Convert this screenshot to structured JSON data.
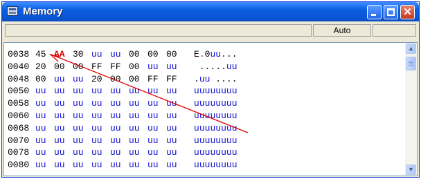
{
  "window": {
    "title": "Memory",
    "auto_label": "Auto",
    "accent_color": "#0a5de0",
    "close_color": "#c4381c"
  },
  "memory": {
    "highlight_color": "#e00000",
    "undefined_color": "#1010d0",
    "rows": [
      {
        "address": "0038",
        "bytes": [
          "45",
          "AA",
          "30",
          "uu",
          "uu",
          "00",
          "00",
          "00"
        ],
        "ascii": "E.0uu..."
      },
      {
        "address": "0040",
        "bytes": [
          "20",
          "00",
          "00",
          "FF",
          "FF",
          "00",
          "uu",
          "uu"
        ],
        "ascii": " .....uu"
      },
      {
        "address": "0048",
        "bytes": [
          "00",
          "uu",
          "uu",
          "20",
          "00",
          "00",
          "FF",
          "FF"
        ],
        "ascii": ".uu ...."
      },
      {
        "address": "0050",
        "bytes": [
          "uu",
          "uu",
          "uu",
          "uu",
          "uu",
          "uu",
          "uu",
          "uu"
        ],
        "ascii": "uuuuuuuu"
      },
      {
        "address": "0058",
        "bytes": [
          "uu",
          "uu",
          "uu",
          "uu",
          "uu",
          "uu",
          "uu",
          "uu"
        ],
        "ascii": "uuuuuuuu"
      },
      {
        "address": "0060",
        "bytes": [
          "uu",
          "uu",
          "uu",
          "uu",
          "uu",
          "uu",
          "uu",
          "uu"
        ],
        "ascii": "uuuuuuuu"
      },
      {
        "address": "0068",
        "bytes": [
          "uu",
          "uu",
          "uu",
          "uu",
          "uu",
          "uu",
          "uu",
          "uu"
        ],
        "ascii": "uuuuuuuu"
      },
      {
        "address": "0070",
        "bytes": [
          "uu",
          "uu",
          "uu",
          "uu",
          "uu",
          "uu",
          "uu",
          "uu"
        ],
        "ascii": "uuuuuuuu"
      },
      {
        "address": "0078",
        "bytes": [
          "uu",
          "uu",
          "uu",
          "uu",
          "uu",
          "uu",
          "uu",
          "uu"
        ],
        "ascii": "uuuuuuuu"
      },
      {
        "address": "0080",
        "bytes": [
          "uu",
          "uu",
          "uu",
          "uu",
          "uu",
          "uu",
          "uu",
          "uu"
        ],
        "ascii": "uuuuuuuu"
      }
    ],
    "highlighted": {
      "row": 0,
      "byte": 1
    }
  },
  "annotation": {
    "arrow_color": "#e00000",
    "points_to": "AA"
  }
}
